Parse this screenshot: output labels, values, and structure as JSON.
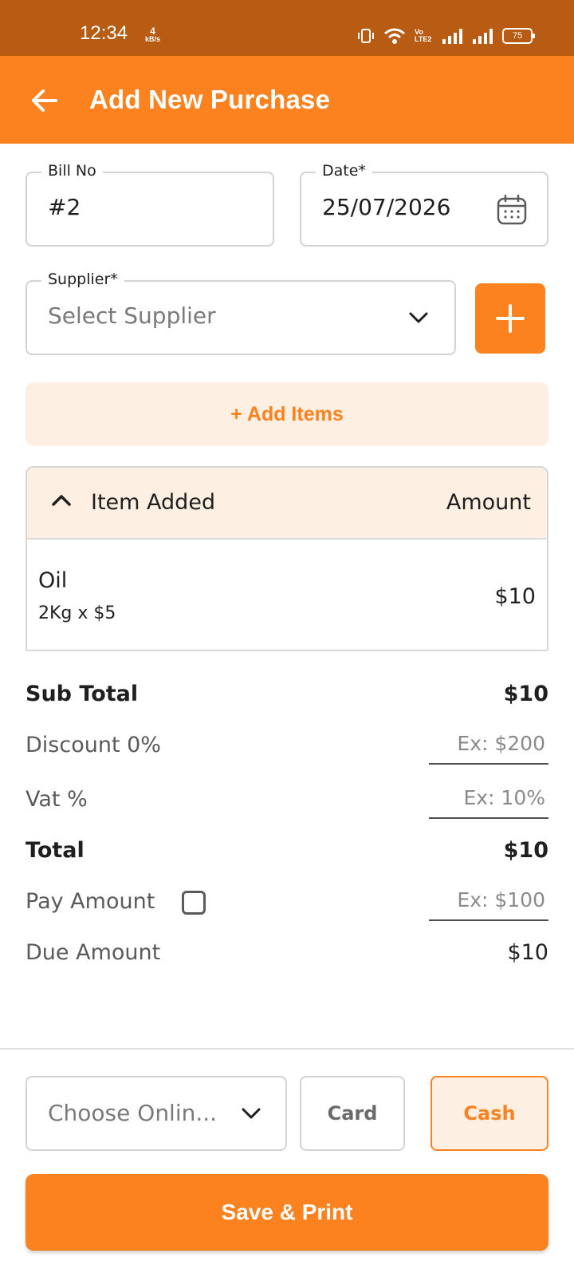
{
  "status_bar": {
    "time": "12:34",
    "speed_value": "4",
    "speed_unit": "kB/s",
    "battery": "75",
    "network_label": "Vo LTE2"
  },
  "header": {
    "title": "Add New Purchase"
  },
  "form": {
    "bill_no": {
      "label": "Bill No",
      "value": "#2"
    },
    "date": {
      "label": "Date*",
      "value": "25/07/2026"
    },
    "supplier": {
      "label": "Supplier*",
      "placeholder": "Select Supplier"
    },
    "add_items_label": "+ Add Items"
  },
  "items_table": {
    "header_item": "Item Added",
    "header_amount": "Amount",
    "rows": [
      {
        "name": "Oil",
        "detail": "2Kg x $5",
        "amount": "$10"
      }
    ]
  },
  "summary": {
    "subtotal_label": "Sub Total",
    "subtotal_value": "$10",
    "discount_label": "Discount 0%",
    "discount_placeholder": "Ex: $200",
    "vat_label": "Vat %",
    "vat_placeholder": "Ex: 10%",
    "total_label": "Total",
    "total_value": "$10",
    "pay_label": "Pay Amount",
    "pay_placeholder": "Ex: $100",
    "due_label": "Due Amount",
    "due_value": "$10"
  },
  "payment": {
    "online_placeholder": "Choose Onlin...",
    "card_label": "Card",
    "cash_label": "Cash",
    "selected": "Cash"
  },
  "actions": {
    "save_label": "Save & Print"
  },
  "colors": {
    "accent": "#fb821e",
    "accent_light": "#feefe3",
    "status_bar": "#b85c14"
  }
}
